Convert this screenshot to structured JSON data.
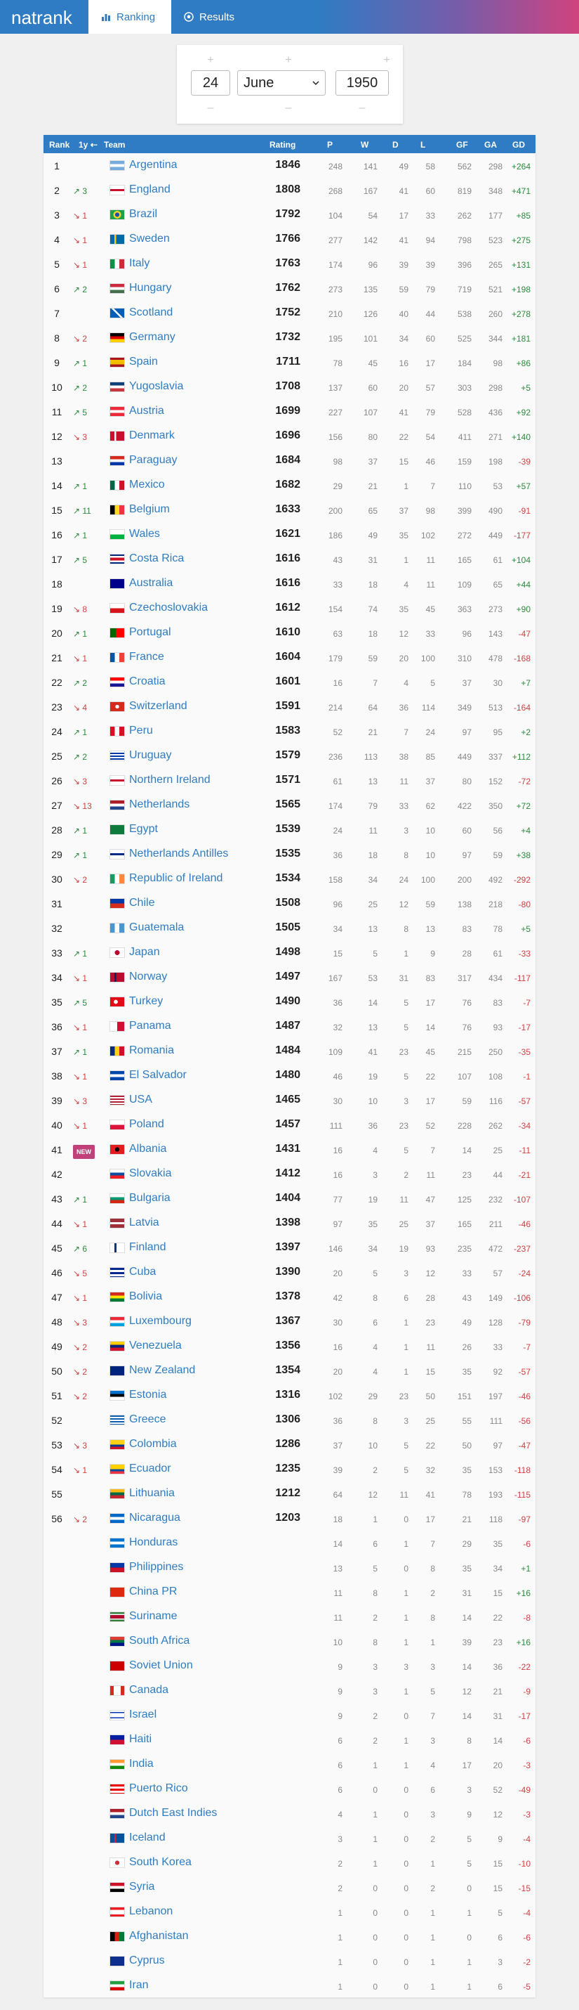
{
  "app": {
    "logo": "natrank",
    "tabs": [
      {
        "label": "Ranking"
      },
      {
        "label": "Results"
      }
    ]
  },
  "date": {
    "day": "24",
    "month": "June",
    "year": "1950"
  },
  "columns": [
    "Rank",
    "1y",
    "Team",
    "Rating",
    "P",
    "W",
    "D",
    "L",
    "GF",
    "GA",
    "GD"
  ],
  "colors": {
    "brand": "#2f7cc4",
    "up": "#2a8a3a",
    "down": "#d04040",
    "new_badge": "#c0407a"
  },
  "rows": [
    {
      "rank": "1",
      "chg": "",
      "team": "Argentina",
      "rating": "1846",
      "p": "248",
      "w": "141",
      "d": "49",
      "l": "58",
      "gf": "562",
      "ga": "298",
      "gd": "+264"
    },
    {
      "rank": "2",
      "chg": "↗ 3",
      "team": "England",
      "rating": "1808",
      "p": "268",
      "w": "167",
      "d": "41",
      "l": "60",
      "gf": "819",
      "ga": "348",
      "gd": "+471"
    },
    {
      "rank": "3",
      "chg": "↘ 1",
      "team": "Brazil",
      "rating": "1792",
      "p": "104",
      "w": "54",
      "d": "17",
      "l": "33",
      "gf": "262",
      "ga": "177",
      "gd": "+85"
    },
    {
      "rank": "4",
      "chg": "↘ 1",
      "team": "Sweden",
      "rating": "1766",
      "p": "277",
      "w": "142",
      "d": "41",
      "l": "94",
      "gf": "798",
      "ga": "523",
      "gd": "+275"
    },
    {
      "rank": "5",
      "chg": "↘ 1",
      "team": "Italy",
      "rating": "1763",
      "p": "174",
      "w": "96",
      "d": "39",
      "l": "39",
      "gf": "396",
      "ga": "265",
      "gd": "+131"
    },
    {
      "rank": "6",
      "chg": "↗ 2",
      "team": "Hungary",
      "rating": "1762",
      "p": "273",
      "w": "135",
      "d": "59",
      "l": "79",
      "gf": "719",
      "ga": "521",
      "gd": "+198"
    },
    {
      "rank": "7",
      "chg": "",
      "team": "Scotland",
      "rating": "1752",
      "p": "210",
      "w": "126",
      "d": "40",
      "l": "44",
      "gf": "538",
      "ga": "260",
      "gd": "+278"
    },
    {
      "rank": "8",
      "chg": "↘ 2",
      "team": "Germany",
      "rating": "1732",
      "p": "195",
      "w": "101",
      "d": "34",
      "l": "60",
      "gf": "525",
      "ga": "344",
      "gd": "+181"
    },
    {
      "rank": "9",
      "chg": "↗ 1",
      "team": "Spain",
      "rating": "1711",
      "p": "78",
      "w": "45",
      "d": "16",
      "l": "17",
      "gf": "184",
      "ga": "98",
      "gd": "+86"
    },
    {
      "rank": "10",
      "chg": "↗ 2",
      "team": "Yugoslavia",
      "rating": "1708",
      "p": "137",
      "w": "60",
      "d": "20",
      "l": "57",
      "gf": "303",
      "ga": "298",
      "gd": "+5"
    },
    {
      "rank": "11",
      "chg": "↗ 5",
      "team": "Austria",
      "rating": "1699",
      "p": "227",
      "w": "107",
      "d": "41",
      "l": "79",
      "gf": "528",
      "ga": "436",
      "gd": "+92"
    },
    {
      "rank": "12",
      "chg": "↘ 3",
      "team": "Denmark",
      "rating": "1696",
      "p": "156",
      "w": "80",
      "d": "22",
      "l": "54",
      "gf": "411",
      "ga": "271",
      "gd": "+140"
    },
    {
      "rank": "13",
      "chg": "",
      "team": "Paraguay",
      "rating": "1684",
      "p": "98",
      "w": "37",
      "d": "15",
      "l": "46",
      "gf": "159",
      "ga": "198",
      "gd": "-39"
    },
    {
      "rank": "14",
      "chg": "↗ 1",
      "team": "Mexico",
      "rating": "1682",
      "p": "29",
      "w": "21",
      "d": "1",
      "l": "7",
      "gf": "110",
      "ga": "53",
      "gd": "+57"
    },
    {
      "rank": "15",
      "chg": "↗ 11",
      "team": "Belgium",
      "rating": "1633",
      "p": "200",
      "w": "65",
      "d": "37",
      "l": "98",
      "gf": "399",
      "ga": "490",
      "gd": "-91"
    },
    {
      "rank": "16",
      "chg": "↗ 1",
      "team": "Wales",
      "rating": "1621",
      "p": "186",
      "w": "49",
      "d": "35",
      "l": "102",
      "gf": "272",
      "ga": "449",
      "gd": "-177"
    },
    {
      "rank": "17",
      "chg": "↗ 5",
      "team": "Costa Rica",
      "rating": "1616",
      "p": "43",
      "w": "31",
      "d": "1",
      "l": "11",
      "gf": "165",
      "ga": "61",
      "gd": "+104"
    },
    {
      "rank": "18",
      "chg": "",
      "team": "Australia",
      "rating": "1616",
      "p": "33",
      "w": "18",
      "d": "4",
      "l": "11",
      "gf": "109",
      "ga": "65",
      "gd": "+44"
    },
    {
      "rank": "19",
      "chg": "↘ 8",
      "team": "Czechoslovakia",
      "rating": "1612",
      "p": "154",
      "w": "74",
      "d": "35",
      "l": "45",
      "gf": "363",
      "ga": "273",
      "gd": "+90"
    },
    {
      "rank": "20",
      "chg": "↗ 1",
      "team": "Portugal",
      "rating": "1610",
      "p": "63",
      "w": "18",
      "d": "12",
      "l": "33",
      "gf": "96",
      "ga": "143",
      "gd": "-47"
    },
    {
      "rank": "21",
      "chg": "↘ 1",
      "team": "France",
      "rating": "1604",
      "p": "179",
      "w": "59",
      "d": "20",
      "l": "100",
      "gf": "310",
      "ga": "478",
      "gd": "-168"
    },
    {
      "rank": "22",
      "chg": "↗ 2",
      "team": "Croatia",
      "rating": "1601",
      "p": "16",
      "w": "7",
      "d": "4",
      "l": "5",
      "gf": "37",
      "ga": "30",
      "gd": "+7"
    },
    {
      "rank": "23",
      "chg": "↘ 4",
      "team": "Switzerland",
      "rating": "1591",
      "p": "214",
      "w": "64",
      "d": "36",
      "l": "114",
      "gf": "349",
      "ga": "513",
      "gd": "-164"
    },
    {
      "rank": "24",
      "chg": "↗ 1",
      "team": "Peru",
      "rating": "1583",
      "p": "52",
      "w": "21",
      "d": "7",
      "l": "24",
      "gf": "97",
      "ga": "95",
      "gd": "+2"
    },
    {
      "rank": "25",
      "chg": "↗ 2",
      "team": "Uruguay",
      "rating": "1579",
      "p": "236",
      "w": "113",
      "d": "38",
      "l": "85",
      "gf": "449",
      "ga": "337",
      "gd": "+112"
    },
    {
      "rank": "26",
      "chg": "↘ 3",
      "team": "Northern Ireland",
      "rating": "1571",
      "p": "61",
      "w": "13",
      "d": "11",
      "l": "37",
      "gf": "80",
      "ga": "152",
      "gd": "-72"
    },
    {
      "rank": "27",
      "chg": "↘ 13",
      "team": "Netherlands",
      "rating": "1565",
      "p": "174",
      "w": "79",
      "d": "33",
      "l": "62",
      "gf": "422",
      "ga": "350",
      "gd": "+72"
    },
    {
      "rank": "28",
      "chg": "↗ 1",
      "team": "Egypt",
      "rating": "1539",
      "p": "24",
      "w": "11",
      "d": "3",
      "l": "10",
      "gf": "60",
      "ga": "56",
      "gd": "+4"
    },
    {
      "rank": "29",
      "chg": "↗ 1",
      "team": "Netherlands Antilles",
      "rating": "1535",
      "p": "36",
      "w": "18",
      "d": "8",
      "l": "10",
      "gf": "97",
      "ga": "59",
      "gd": "+38"
    },
    {
      "rank": "30",
      "chg": "↘ 2",
      "team": "Republic of Ireland",
      "rating": "1534",
      "p": "158",
      "w": "34",
      "d": "24",
      "l": "100",
      "gf": "200",
      "ga": "492",
      "gd": "-292"
    },
    {
      "rank": "31",
      "chg": "",
      "team": "Chile",
      "rating": "1508",
      "p": "96",
      "w": "25",
      "d": "12",
      "l": "59",
      "gf": "138",
      "ga": "218",
      "gd": "-80"
    },
    {
      "rank": "32",
      "chg": "",
      "team": "Guatemala",
      "rating": "1505",
      "p": "34",
      "w": "13",
      "d": "8",
      "l": "13",
      "gf": "83",
      "ga": "78",
      "gd": "+5"
    },
    {
      "rank": "33",
      "chg": "↗ 1",
      "team": "Japan",
      "rating": "1498",
      "p": "15",
      "w": "5",
      "d": "1",
      "l": "9",
      "gf": "28",
      "ga": "61",
      "gd": "-33"
    },
    {
      "rank": "34",
      "chg": "↘ 1",
      "team": "Norway",
      "rating": "1497",
      "p": "167",
      "w": "53",
      "d": "31",
      "l": "83",
      "gf": "317",
      "ga": "434",
      "gd": "-117"
    },
    {
      "rank": "35",
      "chg": "↗ 5",
      "team": "Turkey",
      "rating": "1490",
      "p": "36",
      "w": "14",
      "d": "5",
      "l": "17",
      "gf": "76",
      "ga": "83",
      "gd": "-7"
    },
    {
      "rank": "36",
      "chg": "↘ 1",
      "team": "Panama",
      "rating": "1487",
      "p": "32",
      "w": "13",
      "d": "5",
      "l": "14",
      "gf": "76",
      "ga": "93",
      "gd": "-17"
    },
    {
      "rank": "37",
      "chg": "↗ 1",
      "team": "Romania",
      "rating": "1484",
      "p": "109",
      "w": "41",
      "d": "23",
      "l": "45",
      "gf": "215",
      "ga": "250",
      "gd": "-35"
    },
    {
      "rank": "38",
      "chg": "↘ 1",
      "team": "El Salvador",
      "rating": "1480",
      "p": "46",
      "w": "19",
      "d": "5",
      "l": "22",
      "gf": "107",
      "ga": "108",
      "gd": "-1"
    },
    {
      "rank": "39",
      "chg": "↘ 3",
      "team": "USA",
      "rating": "1465",
      "p": "30",
      "w": "10",
      "d": "3",
      "l": "17",
      "gf": "59",
      "ga": "116",
      "gd": "-57"
    },
    {
      "rank": "40",
      "chg": "↘ 1",
      "team": "Poland",
      "rating": "1457",
      "p": "111",
      "w": "36",
      "d": "23",
      "l": "52",
      "gf": "228",
      "ga": "262",
      "gd": "-34"
    },
    {
      "rank": "41",
      "chg": "NEW",
      "team": "Albania",
      "rating": "1431",
      "p": "16",
      "w": "4",
      "d": "5",
      "l": "7",
      "gf": "14",
      "ga": "25",
      "gd": "-11"
    },
    {
      "rank": "42",
      "chg": "",
      "team": "Slovakia",
      "rating": "1412",
      "p": "16",
      "w": "3",
      "d": "2",
      "l": "11",
      "gf": "23",
      "ga": "44",
      "gd": "-21"
    },
    {
      "rank": "43",
      "chg": "↗ 1",
      "team": "Bulgaria",
      "rating": "1404",
      "p": "77",
      "w": "19",
      "d": "11",
      "l": "47",
      "gf": "125",
      "ga": "232",
      "gd": "-107"
    },
    {
      "rank": "44",
      "chg": "↘ 1",
      "team": "Latvia",
      "rating": "1398",
      "p": "97",
      "w": "35",
      "d": "25",
      "l": "37",
      "gf": "165",
      "ga": "211",
      "gd": "-46"
    },
    {
      "rank": "45",
      "chg": "↗ 6",
      "team": "Finland",
      "rating": "1397",
      "p": "146",
      "w": "34",
      "d": "19",
      "l": "93",
      "gf": "235",
      "ga": "472",
      "gd": "-237"
    },
    {
      "rank": "46",
      "chg": "↘ 5",
      "team": "Cuba",
      "rating": "1390",
      "p": "20",
      "w": "5",
      "d": "3",
      "l": "12",
      "gf": "33",
      "ga": "57",
      "gd": "-24"
    },
    {
      "rank": "47",
      "chg": "↘ 1",
      "team": "Bolivia",
      "rating": "1378",
      "p": "42",
      "w": "8",
      "d": "6",
      "l": "28",
      "gf": "43",
      "ga": "149",
      "gd": "-106"
    },
    {
      "rank": "48",
      "chg": "↘ 3",
      "team": "Luxembourg",
      "rating": "1367",
      "p": "30",
      "w": "6",
      "d": "1",
      "l": "23",
      "gf": "49",
      "ga": "128",
      "gd": "-79"
    },
    {
      "rank": "49",
      "chg": "↘ 2",
      "team": "Venezuela",
      "rating": "1356",
      "p": "16",
      "w": "4",
      "d": "1",
      "l": "11",
      "gf": "26",
      "ga": "33",
      "gd": "-7"
    },
    {
      "rank": "50",
      "chg": "↘ 2",
      "team": "New Zealand",
      "rating": "1354",
      "p": "20",
      "w": "4",
      "d": "1",
      "l": "15",
      "gf": "35",
      "ga": "92",
      "gd": "-57"
    },
    {
      "rank": "51",
      "chg": "↘ 2",
      "team": "Estonia",
      "rating": "1316",
      "p": "102",
      "w": "29",
      "d": "23",
      "l": "50",
      "gf": "151",
      "ga": "197",
      "gd": "-46"
    },
    {
      "rank": "52",
      "chg": "",
      "team": "Greece",
      "rating": "1306",
      "p": "36",
      "w": "8",
      "d": "3",
      "l": "25",
      "gf": "55",
      "ga": "111",
      "gd": "-56"
    },
    {
      "rank": "53",
      "chg": "↘ 3",
      "team": "Colombia",
      "rating": "1286",
      "p": "37",
      "w": "10",
      "d": "5",
      "l": "22",
      "gf": "50",
      "ga": "97",
      "gd": "-47"
    },
    {
      "rank": "54",
      "chg": "↘ 1",
      "team": "Ecuador",
      "rating": "1235",
      "p": "39",
      "w": "2",
      "d": "5",
      "l": "32",
      "gf": "35",
      "ga": "153",
      "gd": "-118"
    },
    {
      "rank": "55",
      "chg": "",
      "team": "Lithuania",
      "rating": "1212",
      "p": "64",
      "w": "12",
      "d": "11",
      "l": "41",
      "gf": "78",
      "ga": "193",
      "gd": "-115"
    },
    {
      "rank": "56",
      "chg": "↘ 2",
      "team": "Nicaragua",
      "rating": "1203",
      "p": "18",
      "w": "1",
      "d": "0",
      "l": "17",
      "gf": "21",
      "ga": "118",
      "gd": "-97"
    },
    {
      "rank": "",
      "chg": "",
      "team": "Honduras",
      "rating": "",
      "p": "14",
      "w": "6",
      "d": "1",
      "l": "7",
      "gf": "29",
      "ga": "35",
      "gd": "-6"
    },
    {
      "rank": "",
      "chg": "",
      "team": "Philippines",
      "rating": "",
      "p": "13",
      "w": "5",
      "d": "0",
      "l": "8",
      "gf": "35",
      "ga": "34",
      "gd": "+1"
    },
    {
      "rank": "",
      "chg": "",
      "team": "China PR",
      "rating": "",
      "p": "11",
      "w": "8",
      "d": "1",
      "l": "2",
      "gf": "31",
      "ga": "15",
      "gd": "+16"
    },
    {
      "rank": "",
      "chg": "",
      "team": "Suriname",
      "rating": "",
      "p": "11",
      "w": "2",
      "d": "1",
      "l": "8",
      "gf": "14",
      "ga": "22",
      "gd": "-8"
    },
    {
      "rank": "",
      "chg": "",
      "team": "South Africa",
      "rating": "",
      "p": "10",
      "w": "8",
      "d": "1",
      "l": "1",
      "gf": "39",
      "ga": "23",
      "gd": "+16"
    },
    {
      "rank": "",
      "chg": "",
      "team": "Soviet Union",
      "rating": "",
      "p": "9",
      "w": "3",
      "d": "3",
      "l": "3",
      "gf": "14",
      "ga": "36",
      "gd": "-22"
    },
    {
      "rank": "",
      "chg": "",
      "team": "Canada",
      "rating": "",
      "p": "9",
      "w": "3",
      "d": "1",
      "l": "5",
      "gf": "12",
      "ga": "21",
      "gd": "-9"
    },
    {
      "rank": "",
      "chg": "",
      "team": "Israel",
      "rating": "",
      "p": "9",
      "w": "2",
      "d": "0",
      "l": "7",
      "gf": "14",
      "ga": "31",
      "gd": "-17"
    },
    {
      "rank": "",
      "chg": "",
      "team": "Haiti",
      "rating": "",
      "p": "6",
      "w": "2",
      "d": "1",
      "l": "3",
      "gf": "8",
      "ga": "14",
      "gd": "-6"
    },
    {
      "rank": "",
      "chg": "",
      "team": "India",
      "rating": "",
      "p": "6",
      "w": "1",
      "d": "1",
      "l": "4",
      "gf": "17",
      "ga": "20",
      "gd": "-3"
    },
    {
      "rank": "",
      "chg": "",
      "team": "Puerto Rico",
      "rating": "",
      "p": "6",
      "w": "0",
      "d": "0",
      "l": "6",
      "gf": "3",
      "ga": "52",
      "gd": "-49"
    },
    {
      "rank": "",
      "chg": "",
      "team": "Dutch East Indies",
      "rating": "",
      "p": "4",
      "w": "1",
      "d": "0",
      "l": "3",
      "gf": "9",
      "ga": "12",
      "gd": "-3"
    },
    {
      "rank": "",
      "chg": "",
      "team": "Iceland",
      "rating": "",
      "p": "3",
      "w": "1",
      "d": "0",
      "l": "2",
      "gf": "5",
      "ga": "9",
      "gd": "-4"
    },
    {
      "rank": "",
      "chg": "",
      "team": "South Korea",
      "rating": "",
      "p": "2",
      "w": "1",
      "d": "0",
      "l": "1",
      "gf": "5",
      "ga": "15",
      "gd": "-10"
    },
    {
      "rank": "",
      "chg": "",
      "team": "Syria",
      "rating": "",
      "p": "2",
      "w": "0",
      "d": "0",
      "l": "2",
      "gf": "0",
      "ga": "15",
      "gd": "-15"
    },
    {
      "rank": "",
      "chg": "",
      "team": "Lebanon",
      "rating": "",
      "p": "1",
      "w": "0",
      "d": "0",
      "l": "1",
      "gf": "1",
      "ga": "5",
      "gd": "-4"
    },
    {
      "rank": "",
      "chg": "",
      "team": "Afghanistan",
      "rating": "",
      "p": "1",
      "w": "0",
      "d": "0",
      "l": "1",
      "gf": "0",
      "ga": "6",
      "gd": "-6"
    },
    {
      "rank": "",
      "chg": "",
      "team": "Cyprus",
      "rating": "",
      "p": "1",
      "w": "0",
      "d": "0",
      "l": "1",
      "gf": "1",
      "ga": "3",
      "gd": "-2"
    },
    {
      "rank": "",
      "chg": "",
      "team": "Iran",
      "rating": "",
      "p": "1",
      "w": "0",
      "d": "0",
      "l": "1",
      "gf": "1",
      "ga": "6",
      "gd": "-5"
    }
  ]
}
